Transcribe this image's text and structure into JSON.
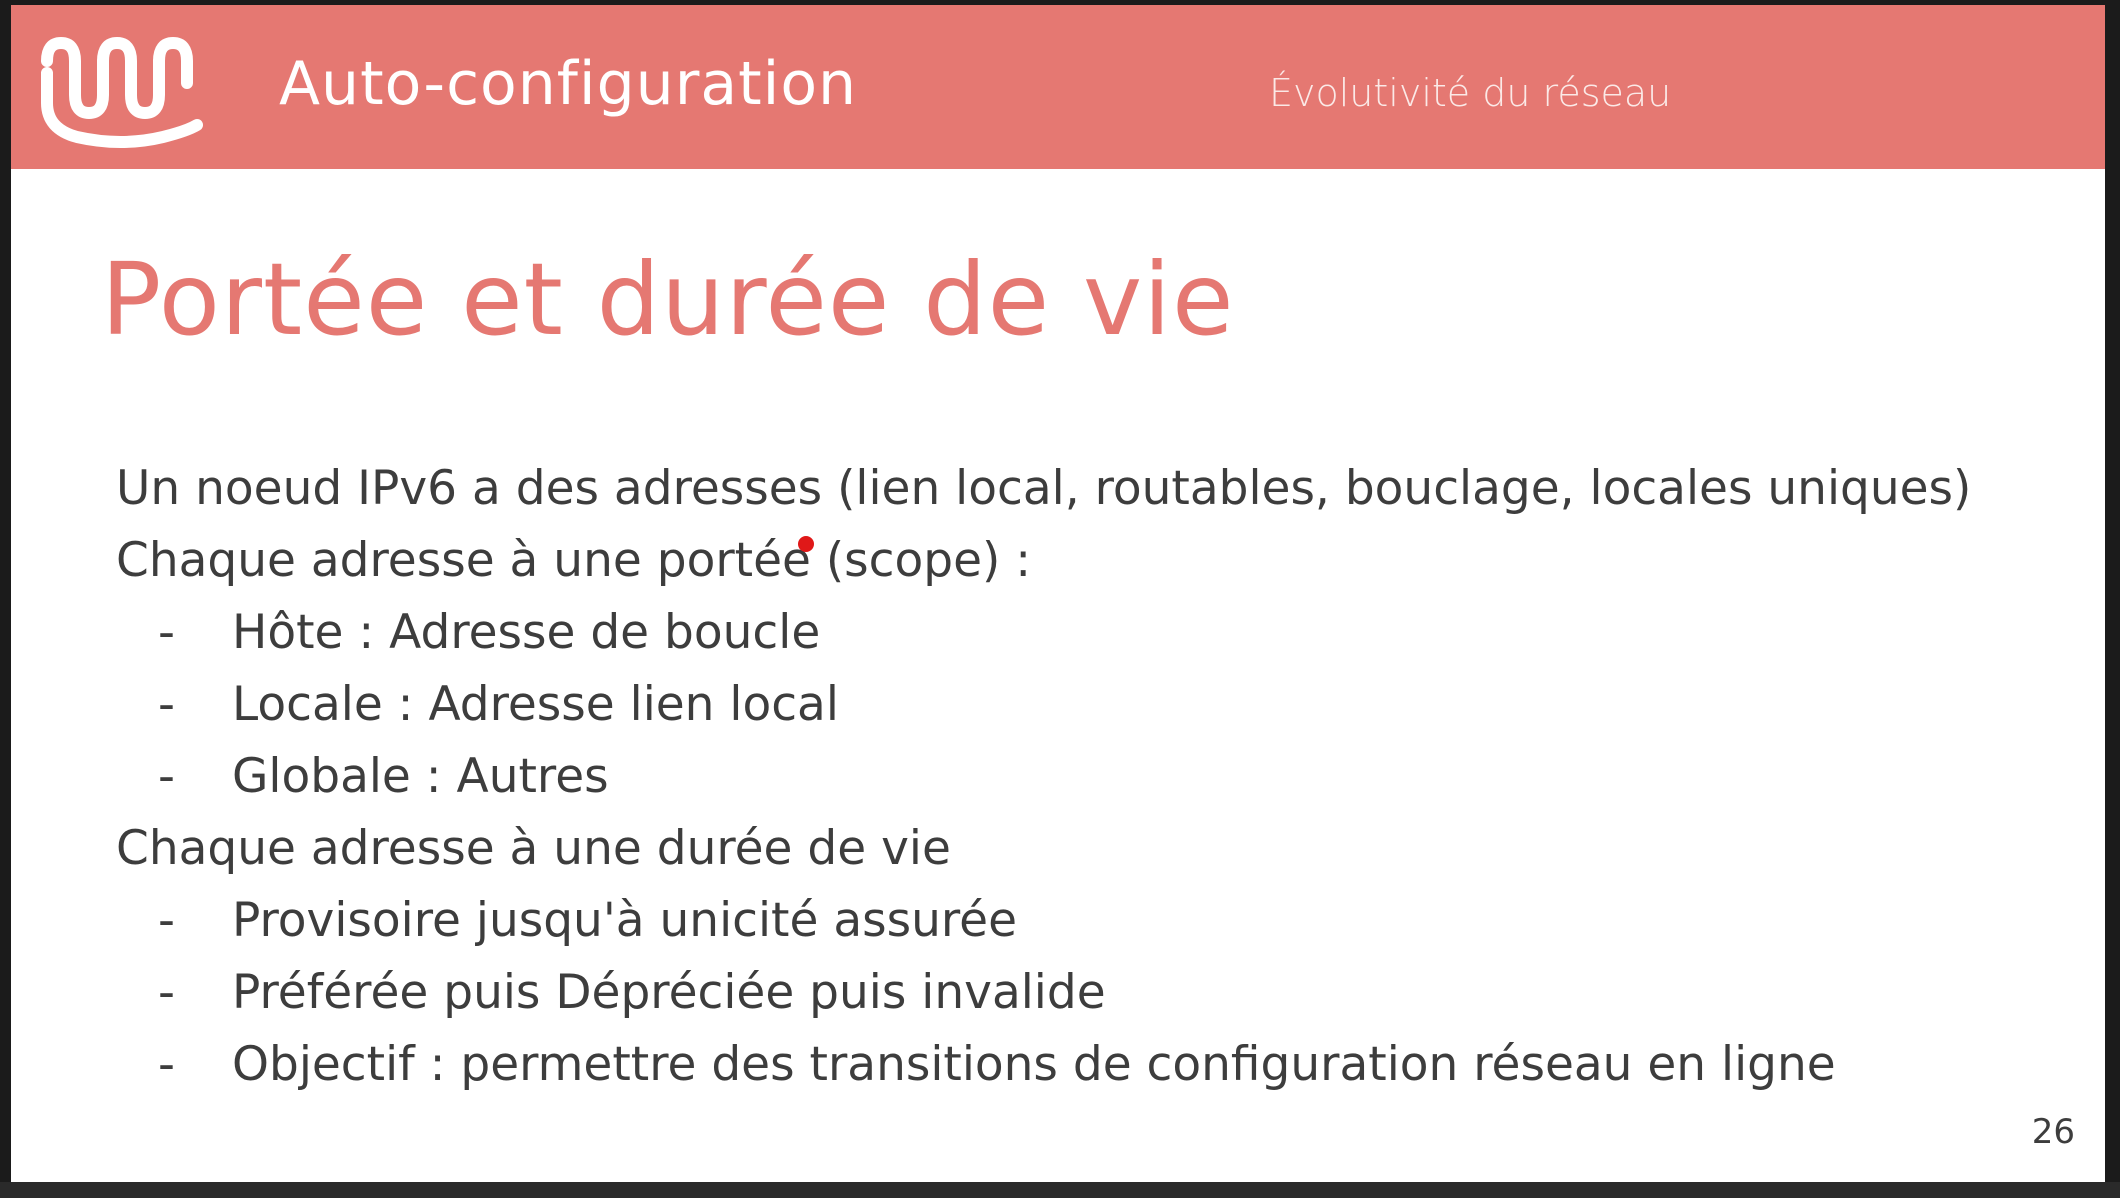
{
  "header": {
    "title": "Auto-configuration",
    "subtitle": "Évolutivité du réseau",
    "logo_icon": "wave-logo-icon"
  },
  "slide": {
    "title": "Portée et durée de vie",
    "lines": [
      "Un noeud IPv6 a des adresses (lien local, routables, bouclage, locales uniques)",
      "Chaque adresse à une portée (scope) :"
    ],
    "scope_items": [
      "Hôte : Adresse de boucle",
      "Locale : Adresse lien local",
      "Globale : Autres"
    ],
    "lifetime_heading": "Chaque adresse à une durée de vie",
    "lifetime_items": [
      "Provisoire jusqu'à unicité assurée",
      "Préférée puis Dépréciée puis invalide",
      "Objectif : permettre des transitions de configuration réseau en ligne"
    ],
    "bullet_marker": "-",
    "page_number": "26"
  },
  "colors": {
    "accent": "#e57872",
    "text": "#3d3d3d",
    "header_text": "#ffffff",
    "laser_pointer": "#e01818"
  }
}
